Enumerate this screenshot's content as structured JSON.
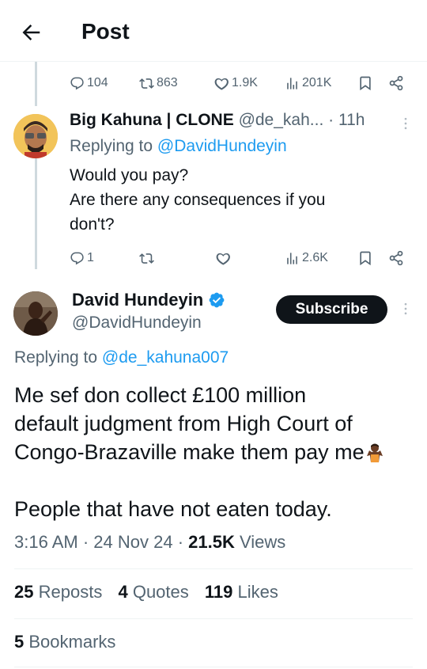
{
  "header": {
    "title": "Post"
  },
  "parent_stats": {
    "replies": "104",
    "reposts": "863",
    "likes": "1.9K",
    "views": "201K"
  },
  "reply": {
    "name": "Big Kahuna | CLONE",
    "handle": "@de_kah...",
    "separator": "·",
    "time": "11h",
    "replying_prefix": "Replying to",
    "replying_handle": "@DavidHundeyin",
    "lines": [
      "Would you pay?",
      "Are there any consequences if you",
      "don't?"
    ],
    "stats": {
      "replies": "1",
      "views": "2.6K"
    }
  },
  "main": {
    "name": "David Hundeyin",
    "handle": "@DavidHundeyin",
    "subscribe_label": "Subscribe",
    "replying_prefix": "Replying to",
    "replying_handle": "@de_kahuna007",
    "text_lines": [
      "Me sef don collect £100 million",
      "default judgment from High Court of",
      "Congo-Brazaville make them pay me"
    ],
    "text_line2": "People that have not eaten today.",
    "time": "3:16 AM",
    "date": "24 Nov 24",
    "views_count": "21.5K",
    "views_label": "Views",
    "dot": "·",
    "reposts_count": "25",
    "reposts_label": "Reposts",
    "quotes_count": "4",
    "quotes_label": "Quotes",
    "likes_count": "119",
    "likes_label": "Likes",
    "bookmarks_count": "5",
    "bookmarks_label": "Bookmarks"
  },
  "colors": {
    "accent": "#1d9bf0",
    "muted": "#536471",
    "text": "#0f1419",
    "divider": "#eff3f4"
  },
  "icons": [
    "back-arrow-icon",
    "reply-icon",
    "repost-icon",
    "like-icon",
    "views-icon",
    "bookmark-icon",
    "share-icon",
    "more-icon",
    "verified-icon",
    "shrug-emoji-icon"
  ]
}
